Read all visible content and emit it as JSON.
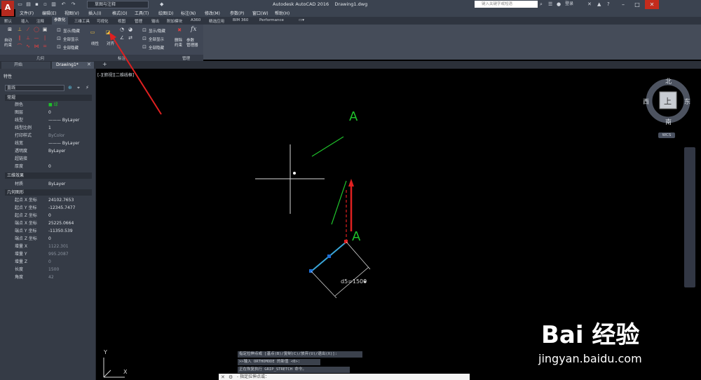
{
  "titlebar": {
    "app_button": "A",
    "workspace": "草图与注释",
    "title": "Autodesk AutoCAD 2016",
    "filename": "Drawing1.dwg",
    "search_placeholder": "键入关键字或短语",
    "login": "登录"
  },
  "menubar": {
    "items": [
      "文件(F)",
      "编辑(E)",
      "视图(V)",
      "插入(I)",
      "格式(O)",
      "工具(T)",
      "绘图(D)",
      "标注(N)",
      "修改(M)",
      "参数(P)",
      "窗口(W)",
      "帮助(H)"
    ]
  },
  "ribbon_tabs": [
    "默认",
    "插入",
    "注释",
    "参数化",
    "三维工具",
    "可视化",
    "视图",
    "管理",
    "输出",
    "附加模块",
    "A360",
    "精选应用",
    "BIM 360",
    "Performance"
  ],
  "ribbon_active_tab": "参数化",
  "ribbon": {
    "auto_constrain": "自动\n约束",
    "show_hide_1": "显示/隐藏",
    "show_all_1": "全部显示",
    "hide_all_1": "全部隐藏",
    "linear": "线性",
    "aligned": "对齐",
    "show_hide_2": "显示/隐藏",
    "show_all_2": "全部显示",
    "hide_all_2": "全部隐藏",
    "delete_constraint": "删除\n约束",
    "param_manager": "参数\n管理器",
    "panels": [
      "几何",
      "标注",
      "管理"
    ]
  },
  "doc_tabs": [
    "开始",
    "Drawing1*"
  ],
  "properties": {
    "title": "特性",
    "type": "直线",
    "sections": {
      "general": "常规",
      "threed": "三维效果",
      "geometry": "几何图形"
    },
    "general_rows": [
      {
        "k": "颜色",
        "v": "■ 绿"
      },
      {
        "k": "图层",
        "v": "0"
      },
      {
        "k": "线型",
        "v": "——— ByLayer"
      },
      {
        "k": "线型比例",
        "v": "1"
      },
      {
        "k": "打印样式",
        "v": "ByColor"
      },
      {
        "k": "线宽",
        "v": "——— ByLayer"
      },
      {
        "k": "透明度",
        "v": "ByLayer"
      },
      {
        "k": "超链接",
        "v": ""
      },
      {
        "k": "厚度",
        "v": "0"
      }
    ],
    "threed_rows": [
      {
        "k": "材质",
        "v": "ByLayer"
      }
    ],
    "geometry_rows": [
      {
        "k": "起点 X 坐标",
        "v": "24102.7653"
      },
      {
        "k": "起点 Y 坐标",
        "v": "-12345.7477"
      },
      {
        "k": "起点 Z 坐标",
        "v": "0"
      },
      {
        "k": "端点 X 坐标",
        "v": "25225.0664"
      },
      {
        "k": "端点 Y 坐标",
        "v": "-11350.539"
      },
      {
        "k": "端点 Z 坐标",
        "v": "0"
      },
      {
        "k": "增量 X",
        "v": "1122.301"
      },
      {
        "k": "增量 Y",
        "v": "995.2087"
      },
      {
        "k": "增量 Z",
        "v": "0"
      },
      {
        "k": "长度",
        "v": "1500"
      },
      {
        "k": "角度",
        "v": "42"
      }
    ]
  },
  "viewport": {
    "label": "[-][俯视][二维线框]",
    "compass": {
      "n": "北",
      "s": "南",
      "e": "东",
      "w": "西",
      "center": "上"
    },
    "wcs": "WCS",
    "dimension": "d5=1500",
    "marker_a": "A"
  },
  "command": {
    "history": [
      "指定拉伸点或 [基点(B)/复制(C)/放弃(U)/退出(X)]:",
      ">>输入 ORTHOMODE 的新值 <0>:",
      "正在恢复执行 GRIP_STRETCH 命令。"
    ],
    "prompt": "- 指定拉伸点或："
  },
  "watermark": {
    "brand": "Bai 经验",
    "url": "jingyan.baidu.com"
  },
  "colors": {
    "accent_red": "#b72a1f",
    "line_green": "#1fc22b",
    "grip_blue": "#1e6fd6",
    "arrow_red": "#e02020"
  }
}
